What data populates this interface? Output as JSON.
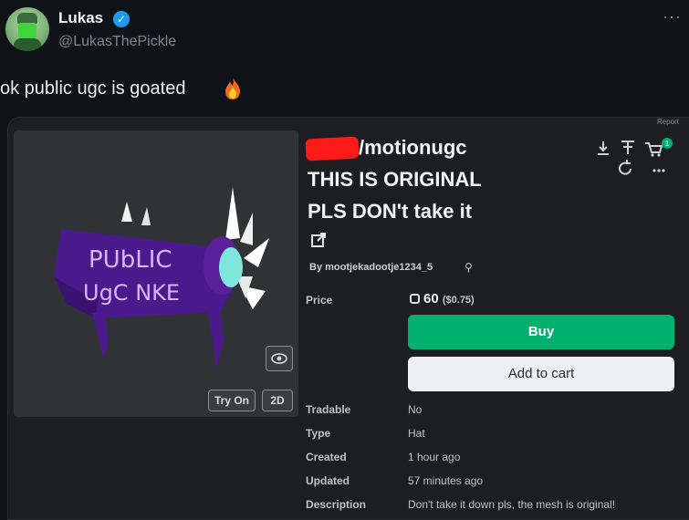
{
  "tweet": {
    "author_name": "Lukas",
    "author_handle": "@LukasThePickle",
    "more_label": "···",
    "text": "ok public ugc is goated",
    "verified_color": "#1d9bf0"
  },
  "item": {
    "title_lines": [
      "/motionugc",
      "THIS IS ORIGINAL",
      "PLS DON't take it"
    ],
    "creator": "By mootjekadootje1234_5",
    "price_label": "Price",
    "price": "60",
    "price_usd": "($0.75)",
    "buy_label": "Buy",
    "cart_label": "Add to cart",
    "try_on_label": "Try On",
    "view_2d_label": "2D",
    "mesh_text": [
      "PUbLIC",
      "UgC NKE"
    ],
    "details": [
      {
        "label": "Tradable",
        "value": "No"
      },
      {
        "label": "Type",
        "value": "Hat"
      },
      {
        "label": "Created",
        "value": "1 hour ago"
      },
      {
        "label": "Updated",
        "value": "57 minutes ago"
      },
      {
        "label": "Description",
        "value": "Don't take it down pls, the mesh is original!"
      }
    ],
    "cart_badge": "1",
    "buy_color": "#00b06f"
  }
}
